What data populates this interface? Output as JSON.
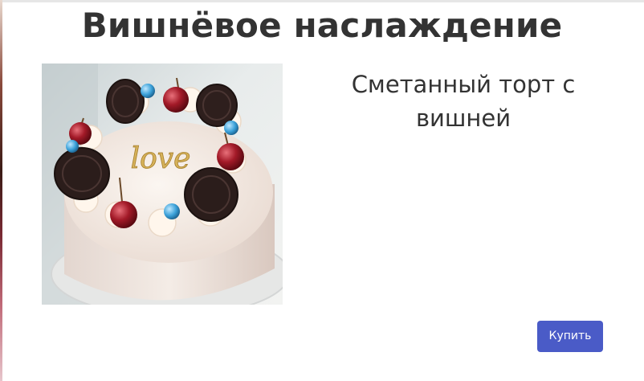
{
  "product": {
    "title": "Вишнёвое наслаждение",
    "description": "Сметанный торт с вишней",
    "image_subject": "cake-photo",
    "image_inscription": "love"
  },
  "actions": {
    "buy_label": "Купить"
  },
  "colors": {
    "button": "#4a5bc7",
    "text": "#333333"
  }
}
